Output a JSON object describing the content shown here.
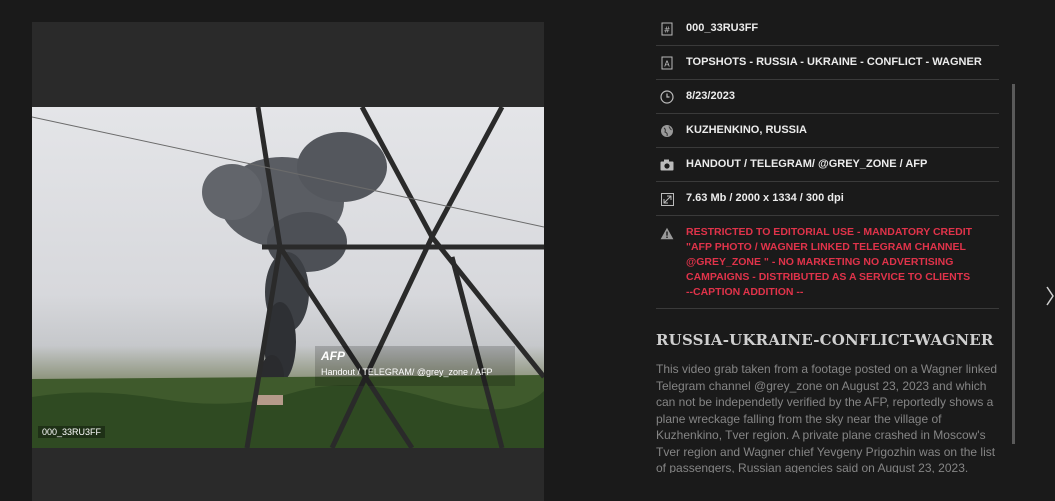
{
  "photo": {
    "code_overlay": "000_33RU3FF",
    "watermark_logo": "AFP",
    "watermark_credit": "Handout / TELEGRAM/ @grey_zone / AFP"
  },
  "details": {
    "id": "000_33RU3FF",
    "title": "TOPSHOTS - RUSSIA - UKRAINE - CONFLICT - WAGNER",
    "date": "8/23/2023",
    "location": "KUZHENKINO, RUSSIA",
    "credit": "HANDOUT / TELEGRAM/ @GREY_ZONE / AFP",
    "file_info": "7.63 Mb / 2000 x 1334 / 300 dpi",
    "restriction": "RESTRICTED TO EDITORIAL USE - MANDATORY CREDIT \"AFP PHOTO / WAGNER LINKED TELEGRAM CHANNEL @GREY_ZONE \" - NO MARKETING NO ADVERTISING CAMPAIGNS - DISTRIBUTED AS A SERVICE TO CLIENTS",
    "restriction_addition": "--CAPTION ADDITION --"
  },
  "headline": "RUSSIA-UKRAINE-CONFLICT-WAGNER",
  "caption": "This video grab taken from a footage posted on a Wagner linked Telegram channel @grey_zone on August 23, 2023 and which can not be independetly verified by the AFP, reportedly shows a plane wreckage falling from the sky near the village of Kuzhenkino, Tver region. A private plane crashed in Moscow's Tver region and Wagner chief Yevgeny Prigozhin was on the list of passengers, Russian agencies said on August 23, 2023.",
  "colors": {
    "restriction": "#e0334a",
    "background": "#1a1a1a",
    "panel_text": "#ececec"
  },
  "icons": [
    "hash-icon",
    "letter-a-icon",
    "clock-icon",
    "globe-icon",
    "camera-icon",
    "resize-icon",
    "warning-icon",
    "chevron-right-icon"
  ]
}
